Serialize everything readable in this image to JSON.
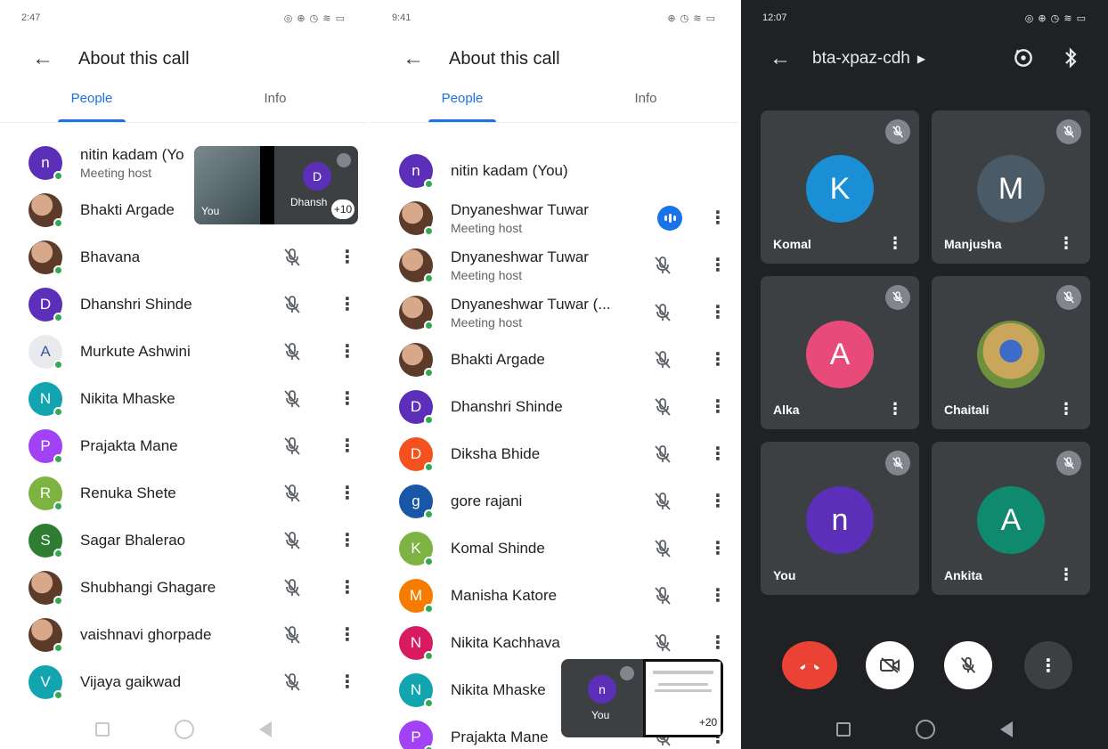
{
  "panel1": {
    "status": {
      "time": "2:47",
      "icons": "◎ ⊕ ◷ ≋ ▭"
    },
    "title": "About this call",
    "tabs": [
      "People",
      "Info"
    ],
    "rows": [
      {
        "name": "nitin kadam (Yo",
        "sub": "Meeting host",
        "initial": "n",
        "color": "#5b2fb8",
        "photo": false
      },
      {
        "name": "Bhakti Argade",
        "initial": "",
        "color": "",
        "photo": true
      },
      {
        "name": "Bhavana",
        "initial": "",
        "color": "",
        "photo": true
      },
      {
        "name": "Dhanshri Shinde",
        "initial": "D",
        "color": "#5b2fb8",
        "photo": false
      },
      {
        "name": "Murkute Ashwini",
        "initial": "A",
        "color": "#e8eaed",
        "photo": false,
        "text_color": "#3c5a9a"
      },
      {
        "name": "Nikita Mhaske",
        "initial": "N",
        "color": "#12a4af",
        "photo": false
      },
      {
        "name": "Prajakta Mane",
        "initial": "P",
        "color": "#a142f4",
        "photo": false
      },
      {
        "name": "Renuka Shete",
        "initial": "R",
        "color": "#7cb342",
        "photo": false
      },
      {
        "name": "Sagar Bhalerao",
        "initial": "S",
        "color": "#2e7d32",
        "photo": false
      },
      {
        "name": "Shubhangi Ghagare",
        "initial": "",
        "color": "",
        "photo": true
      },
      {
        "name": "vaishnavi ghorpade",
        "initial": "",
        "color": "",
        "photo": true
      },
      {
        "name": "Vijaya gaikwad",
        "initial": "V",
        "color": "#12a4af",
        "photo": false
      }
    ],
    "pip": {
      "self_label": "You",
      "other_label": "Dhansh",
      "other_initial": "D",
      "extra": "+10"
    }
  },
  "panel2": {
    "status": {
      "time": "9:41",
      "icons": "⊕ ◷ ≋ ▭"
    },
    "title": "About this call",
    "tabs": [
      "People",
      "Info"
    ],
    "rows": [
      {
        "name": "nitin kadam (You)",
        "initial": "n",
        "color": "#5b2fb8",
        "photo": false
      },
      {
        "name": "Dnyaneshwar Tuwar",
        "sub": "Meeting host",
        "photo": true,
        "speaking": true
      },
      {
        "name": "Dnyaneshwar Tuwar",
        "sub": "Meeting host",
        "photo": true
      },
      {
        "name": "Dnyaneshwar Tuwar (...",
        "sub": "Meeting host",
        "photo": true
      },
      {
        "name": "Bhakti Argade",
        "photo": true
      },
      {
        "name": "Dhanshri Shinde",
        "initial": "D",
        "color": "#5b2fb8",
        "photo": false
      },
      {
        "name": "Diksha Bhide",
        "initial": "D",
        "color": "#f4511e",
        "photo": false
      },
      {
        "name": "gore rajani",
        "initial": "g",
        "color": "#1a56a8",
        "photo": false
      },
      {
        "name": "Komal Shinde",
        "initial": "K",
        "color": "#7cb342",
        "photo": false
      },
      {
        "name": "Manisha Katore",
        "initial": "M",
        "color": "#f57c00",
        "photo": false
      },
      {
        "name": "Nikita Kachhava",
        "initial": "N",
        "color": "#d81b60",
        "photo": false
      },
      {
        "name": "Nikita Mhaske",
        "initial": "N",
        "color": "#12a4af",
        "photo": false
      },
      {
        "name": "Prajakta Mane",
        "initial": "P",
        "color": "#a142f4",
        "photo": false
      }
    ],
    "pip": {
      "self_label": "You",
      "self_initial": "n",
      "extra": "+20"
    }
  },
  "panel3": {
    "status": {
      "time": "12:07",
      "icons": "◎ ⊕ ◷ ≋ ▭"
    },
    "meeting_code": "bta-xpaz-cdh",
    "tiles": [
      {
        "name": "Komal",
        "initial": "K",
        "color": "#1a8fd6",
        "more": true
      },
      {
        "name": "Manjusha",
        "initial": "M",
        "color": "#4a5a66",
        "more": true
      },
      {
        "name": "Alka",
        "initial": "A",
        "color": "#e84a7a",
        "more": true
      },
      {
        "name": "Chaitali",
        "initial": "",
        "color": "",
        "photo": true,
        "more": true
      },
      {
        "name": "You",
        "initial": "n",
        "color": "#5b2fb8",
        "more": false
      },
      {
        "name": "Ankita",
        "initial": "A",
        "color": "#0f8a6e",
        "more": true
      }
    ]
  }
}
